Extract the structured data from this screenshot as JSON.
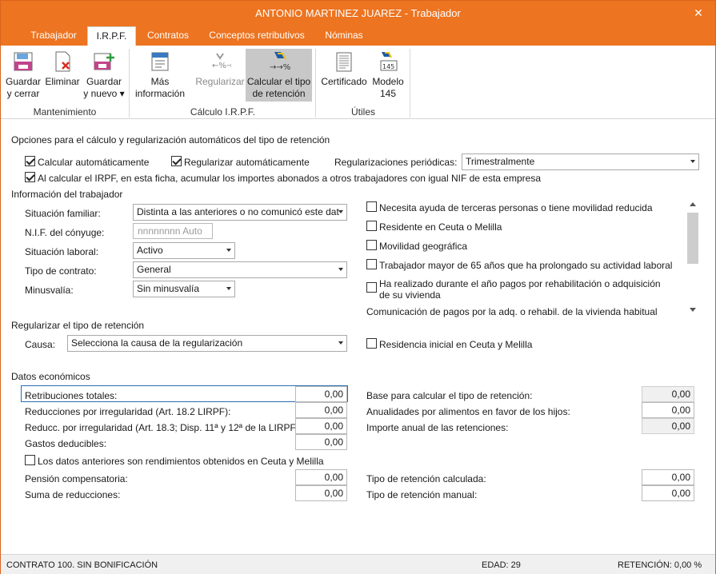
{
  "window": {
    "title": "ANTONIO MARTINEZ JUAREZ - Trabajador"
  },
  "tabs": [
    "Trabajador",
    "I.R.P.F.",
    "Contratos",
    "Conceptos retributivos",
    "Nóminas"
  ],
  "ribbon": {
    "save_close": "Guardar\ny cerrar",
    "delete": "Eliminar",
    "save_new": "Guardar\ny nuevo ▾",
    "group_maintenance": "Mantenimiento",
    "more_info": "Más\ninformación",
    "regularize": "Regularizar",
    "calc_rate": "Calcular el tipo\nde retención",
    "group_calc": "Cálculo I.R.P.F.",
    "certificate": "Certificado",
    "model145": "Modelo\n145",
    "group_utils": "Útiles",
    "accent": "#ed7420"
  },
  "options": {
    "title": "Opciones para el cálculo y regularización automáticos del tipo de retención",
    "auto_calc": "Calcular automáticamente",
    "auto_reg": "Regularizar automáticamente",
    "periodic_label": "Regularizaciones periódicas:",
    "periodic_value": "Trimestralmente",
    "accumulate": "Al calcular el IRPF, en esta ficha, acumular los importes abonados a otros trabajadores con igual NIF de esta empresa"
  },
  "worker": {
    "title": "Información del trabajador",
    "family_label": "Situación familiar:",
    "family_value": "Distinta a las anteriores o no comunicó este dat",
    "spouse_nif_label": "N.I.F. del cónyuge:",
    "spouse_nif_placeholder": "nnnnnnnn Auto",
    "work_status_label": "Situación laboral:",
    "work_status_value": "Activo",
    "contract_label": "Tipo de contrato:",
    "contract_value": "General",
    "disability_label": "Minusvalía:",
    "disability_value": "Sin minusvalía",
    "check_help": "Necesita ayuda de terceras personas o tiene movilidad reducida",
    "check_ceuta": "Residente en Ceuta o Melilla",
    "check_mobility": "Movilidad geográfica",
    "check_over65": "Trabajador mayor de 65 años que ha prolongado su actividad laboral",
    "check_housing_1": "Ha realizado durante el año pagos por rehabilitación o adquisición",
    "check_housing_2": "de su vivienda",
    "housing_comm": "Comunicación de pagos por la adq. o rehabil. de la vivienda habitual"
  },
  "regularize": {
    "title": "Regularizar el tipo de retención",
    "cause_label": "Causa:",
    "cause_value": "Selecciona la causa de la regularización",
    "initial_ceuta": "Residencia inicial en Ceuta y Melilla"
  },
  "economic": {
    "title": "Datos económicos",
    "total_pay_label": "Retribuciones totales:",
    "total_pay": "0,00",
    "irregular_red_label": "Reducciones por irregularidad (Art. 18.2 LIRPF):",
    "irregular_red": "0,00",
    "irregular_red2_label": "Reducc. por irregularidad (Art. 18.3; Disp. 11ª y 12ª de la LIRPF):",
    "irregular_red2": "0,00",
    "deductible_label": "Gastos deducibles:",
    "deductible": "0,00",
    "ceuta_income": "Los datos anteriores son rendimientos obtenidos en Ceuta y Melilla",
    "pension_label": "Pensión compensatoria:",
    "pension": "0,00",
    "reductions_sum_label": "Suma de reducciones:",
    "reductions_sum": "0,00",
    "base_label": "Base para calcular el tipo de retención:",
    "base": "0,00",
    "annuities_label": "Anualidades por alimentos en favor de los hijos:",
    "annuities": "0,00",
    "annual_ret_label": "Importe anual de las retenciones:",
    "annual_ret": "0,00",
    "calc_rate_label": "Tipo de retención calculada:",
    "calc_rate": "0,00",
    "manual_rate_label": "Tipo de retención manual:",
    "manual_rate": "0,00"
  },
  "status": {
    "contract": "CONTRATO 100.  SIN BONIFICACIÓN",
    "age": "EDAD: 29",
    "retention": "RETENCIÓN: 0,00 %"
  }
}
